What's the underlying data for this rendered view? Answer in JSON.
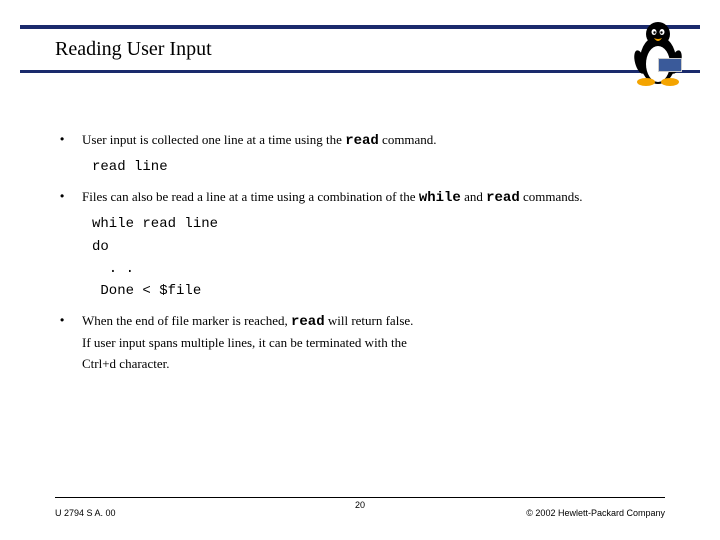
{
  "title": "Reading User Input",
  "bullets": [
    {
      "pre": "User input is collected one line at a time using the ",
      "code": "read",
      "post": " command."
    },
    {
      "pre": "Files can also be read a line at a time using a combination of the ",
      "code": "while",
      "mid": " and ",
      "code2": "read",
      "post": " commands."
    },
    {
      "pre": "When the end of file marker is reached, ",
      "code": "read",
      "post": " will return false.",
      "line2": "If user input spans multiple lines, it can be terminated with the",
      "line3": "Ctrl+d character."
    }
  ],
  "code_blocks": {
    "block1": "read line",
    "block2": "while read line\ndo\n  . .\n Done < $file"
  },
  "footer": {
    "left": "U 2794 S A. 00",
    "center": "20",
    "right": "© 2002 Hewlett-Packard Company"
  },
  "icons": {
    "penguin": "penguin-icon",
    "hp": "hp-logo"
  }
}
